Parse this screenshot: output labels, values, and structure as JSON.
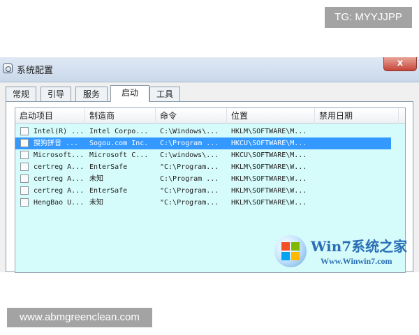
{
  "badges": {
    "telegram": "TG: MYYJJPP",
    "website": "www.abmgreenclean.com"
  },
  "window": {
    "title": "系统配置",
    "close_label": "x"
  },
  "tabs": [
    {
      "label": "常规",
      "active": false
    },
    {
      "label": "引导",
      "active": false
    },
    {
      "label": "服务",
      "active": false
    },
    {
      "label": "启动",
      "active": true
    },
    {
      "label": "工具",
      "active": false
    }
  ],
  "startup_list": {
    "columns": [
      "启动项目",
      "制造商",
      "命令",
      "位置",
      "禁用日期"
    ],
    "rows": [
      {
        "checked": false,
        "selected": false,
        "cells": [
          "Intel(R) ...",
          "Intel Corpo...",
          "C:\\Windows\\...",
          "HKLM\\SOFTWARE\\M...",
          ""
        ]
      },
      {
        "checked": false,
        "selected": true,
        "cells": [
          "搜狗拼音 ...",
          "Sogou.com Inc.",
          "C:\\Program ...",
          "HKCU\\SOFTWARE\\M...",
          ""
        ]
      },
      {
        "checked": false,
        "selected": false,
        "cells": [
          "Microsoft...",
          "Microsoft C...",
          "C:\\windows\\...",
          "HKCU\\SOFTWARE\\M...",
          ""
        ]
      },
      {
        "checked": false,
        "selected": false,
        "cells": [
          "certreg A...",
          "EnterSafe",
          "\"C:\\Program...",
          "HKLM\\SOFTWARE\\W...",
          ""
        ]
      },
      {
        "checked": false,
        "selected": false,
        "cells": [
          "certreg A...",
          "未知",
          "C:\\Program ...",
          "HKLM\\SOFTWARE\\W...",
          ""
        ]
      },
      {
        "checked": false,
        "selected": false,
        "cells": [
          "certreg A...",
          "EnterSafe",
          "\"C:\\Program...",
          "HKLM\\SOFTWARE\\W...",
          ""
        ]
      },
      {
        "checked": false,
        "selected": false,
        "cells": [
          "HengBao U...",
          "未知",
          "\"C:\\Program...",
          "HKLM\\SOFTWARE\\W...",
          ""
        ]
      }
    ]
  },
  "logo": {
    "title": "Win7系统之家",
    "url": "Www.Winwin7.com"
  },
  "colors": {
    "list_background": "#d6fbfb",
    "selection": "#3399ff",
    "badge": "#a3a3a3",
    "logo_blue": "#2a6fb5"
  }
}
